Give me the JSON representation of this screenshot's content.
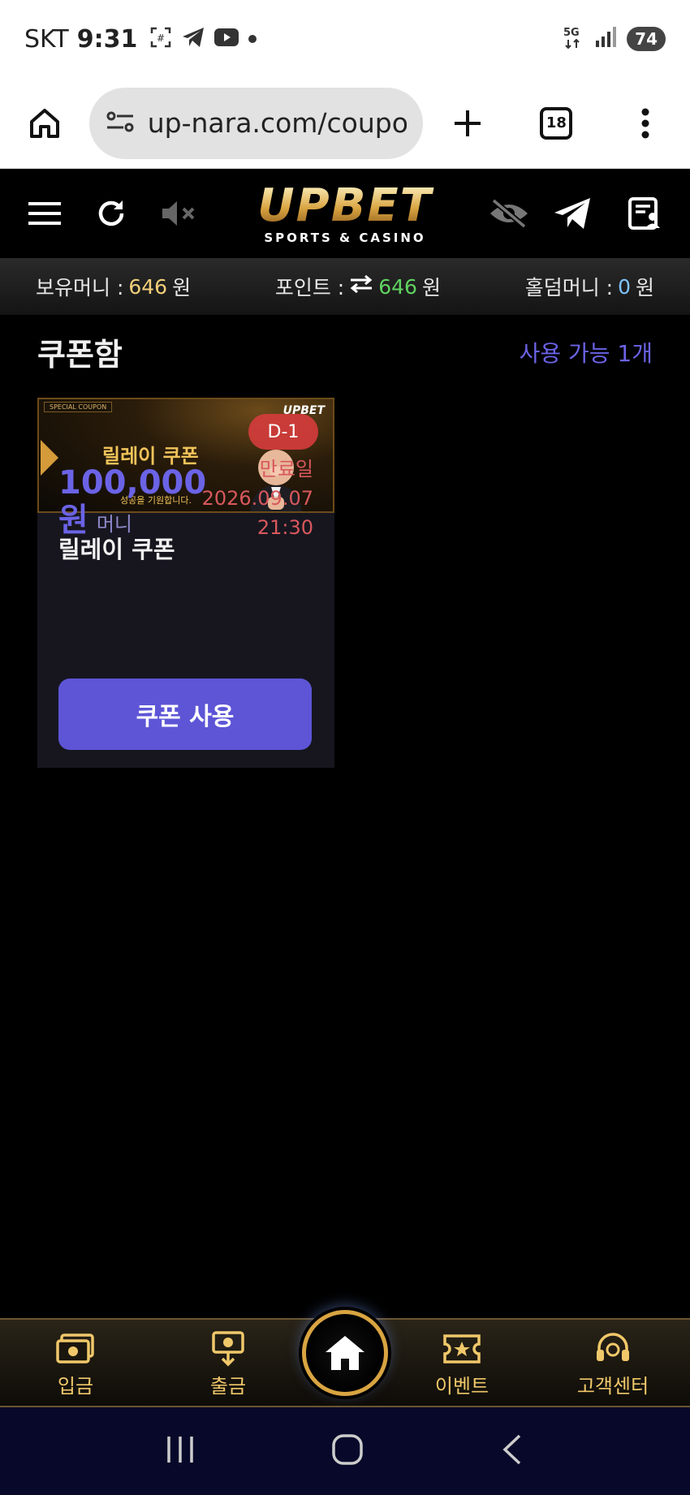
{
  "status_bar": {
    "carrier": "SKT",
    "time": "9:31",
    "network": "5G",
    "battery": "74"
  },
  "browser": {
    "url": "up-nara.com/coupor",
    "tab_count": "18"
  },
  "header": {
    "logo_text": "UPBET",
    "logo_subtitle": "SPORTS & CASINO"
  },
  "balance": {
    "money_label": "보유머니 :",
    "money_value": "646",
    "points_label": "포인트 :",
    "points_value": "646",
    "holdem_label": "홀덤머니 :",
    "holdem_value": "0",
    "unit": "원"
  },
  "coupon_box": {
    "title": "쿠폰함",
    "available_text": "사용 가능 1개",
    "coupons": [
      {
        "banner_special": "SPECIAL COUPON",
        "banner_title": "릴레이 쿠폰",
        "banner_tagline": "성공을 기원합니다.",
        "banner_logo": "UPBET",
        "d_badge": "D-1",
        "name": "릴레이 쿠폰",
        "amount": "100,000",
        "amount_unit": "원",
        "amount_type": "머니",
        "expiry_label": "만료일",
        "expiry_date": "2026.09.07",
        "expiry_time": "21:30",
        "use_button": "쿠폰 사용"
      }
    ]
  },
  "bottom_nav": {
    "deposit": "입금",
    "withdraw": "출금",
    "event": "이벤트",
    "support": "고객센터"
  }
}
